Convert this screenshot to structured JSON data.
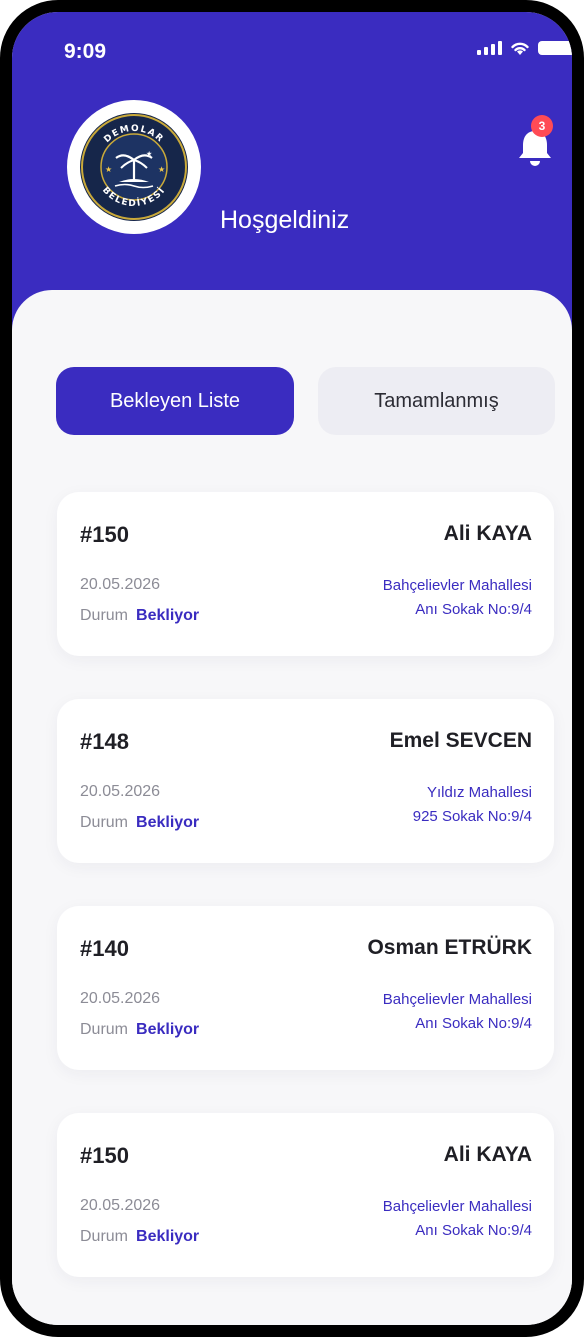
{
  "status_bar": {
    "time": "9:09"
  },
  "header": {
    "welcome": "Hoşgeldiniz",
    "notification_count": "3",
    "logo_text_top": "DEMOLAR",
    "logo_text_bottom": "BELEDİYESİ"
  },
  "tabs": [
    {
      "label": "Bekleyen Liste",
      "active": true
    },
    {
      "label": "Tamamlanmış",
      "active": false
    }
  ],
  "items": [
    {
      "number": "#150",
      "name": "Ali KAYA",
      "date": "20.05.2026",
      "status_label": "Durum",
      "status": "Bekliyor",
      "address_line1": "Bahçelievler Mahallesi",
      "address_line2": "Anı Sokak No:9/4"
    },
    {
      "number": "#148",
      "name": "Emel SEVCEN",
      "date": "20.05.2026",
      "status_label": "Durum",
      "status": "Bekliyor",
      "address_line1": "Yıldız Mahallesi",
      "address_line2": "925 Sokak No:9/4"
    },
    {
      "number": "#140",
      "name": "Osman ETRÜRK",
      "date": "20.05.2026",
      "status_label": "Durum",
      "status": "Bekliyor",
      "address_line1": "Bahçelievler Mahallesi",
      "address_line2": "Anı Sokak No:9/4"
    },
    {
      "number": "#150",
      "name": "Ali KAYA",
      "date": "20.05.2026",
      "status_label": "Durum",
      "status": "Bekliyor",
      "address_line1": "Bahçelievler Mahallesi",
      "address_line2": "Anı Sokak No:9/4"
    }
  ],
  "colors": {
    "primary": "#3a2cc0",
    "badge": "#ff4b55",
    "muted_text": "#8c8c96"
  }
}
